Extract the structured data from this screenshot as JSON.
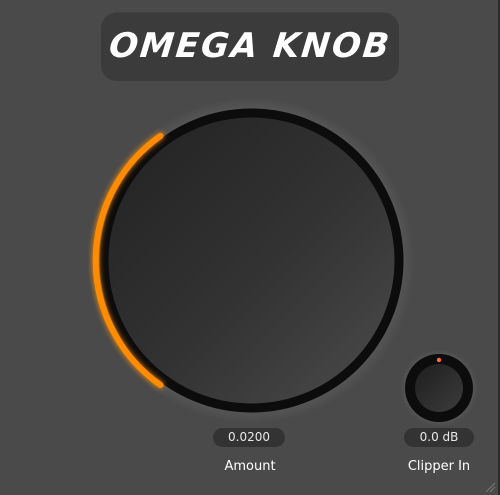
{
  "title": "OMEGA KNOB",
  "main_knob": {
    "label": "Amount",
    "value_text": "0.0200",
    "accent_color": "#ff8c00"
  },
  "small_knob": {
    "label": "Clipper In",
    "value_text": "0.0 dB",
    "indicator_color": "#ff6a3a"
  },
  "icons": {
    "resize": "resize-grip-icon"
  }
}
